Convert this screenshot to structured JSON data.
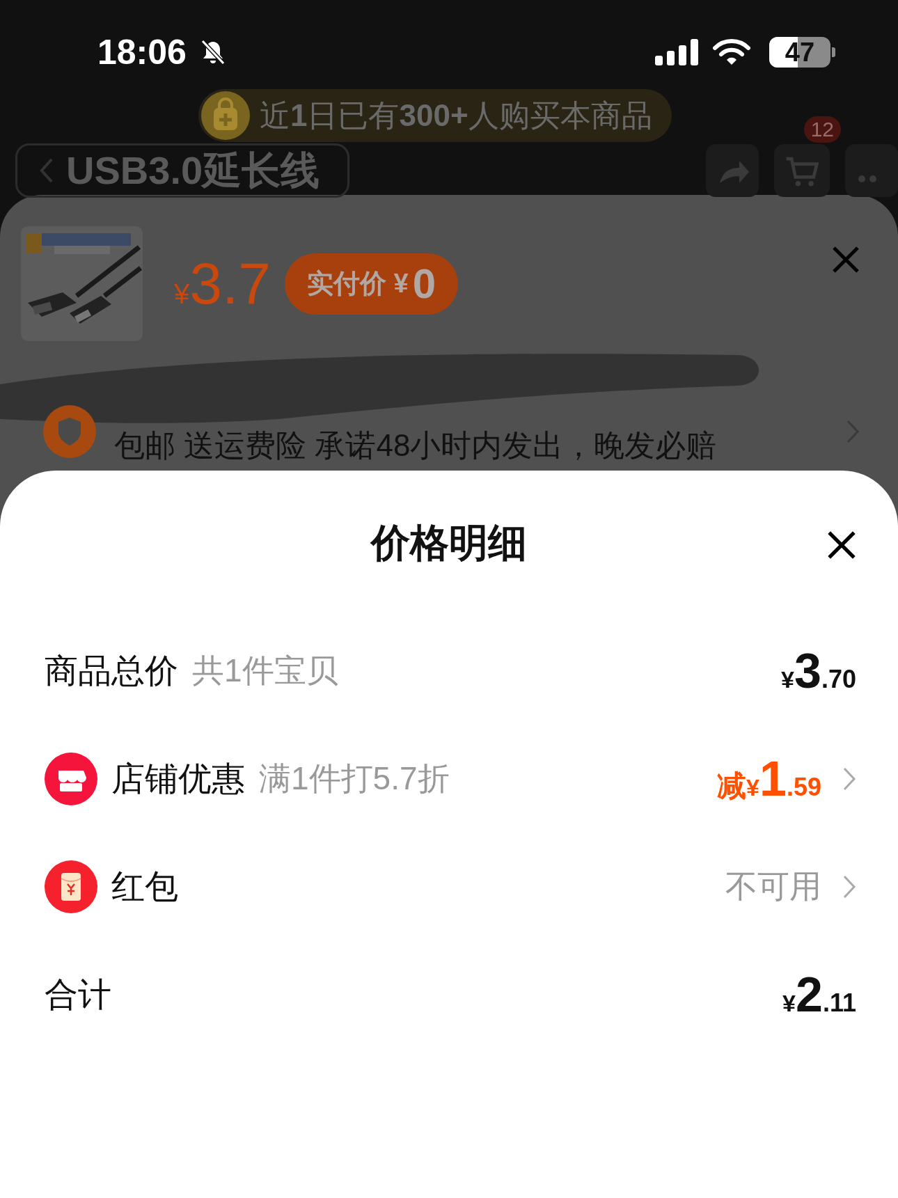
{
  "status_bar": {
    "time": "18:06",
    "battery": "47"
  },
  "background_page": {
    "banner": {
      "parts": [
        {
          "text": "近",
          "bold": false
        },
        {
          "text": "1",
          "bold": true
        },
        {
          "text": "日已有",
          "bold": false
        },
        {
          "text": "300+",
          "bold": true
        },
        {
          "text": "人购买本商品",
          "bold": false
        }
      ]
    },
    "title": "USB3.0延长线",
    "cart_badge": "12"
  },
  "product_sheet": {
    "price": {
      "currency": "¥",
      "amount": "3.7"
    },
    "paid_price": {
      "label": "实付价 ¥",
      "amount": "0"
    },
    "shipping": "包邮 送运费险 承诺48小时内发出，晚发必赔"
  },
  "price_detail": {
    "title": "价格明细",
    "rows": [
      {
        "kind": "plain",
        "label": "商品总价",
        "note": "共1件宝贝",
        "price": {
          "currency": "¥",
          "integer": "3",
          "decimal": ".70"
        },
        "arrow": false
      },
      {
        "kind": "discount",
        "label": "店铺优惠",
        "note": "满1件打5.7折",
        "price": {
          "prefix": "减",
          "currency": "¥",
          "integer": "1",
          "decimal": ".59"
        },
        "arrow": true
      },
      {
        "kind": "packet",
        "label": "红包",
        "value": "不可用",
        "arrow": true
      },
      {
        "kind": "plain",
        "label": "合计",
        "price": {
          "currency": "¥",
          "integer": "2",
          "decimal": ".11"
        },
        "arrow": false
      }
    ]
  }
}
